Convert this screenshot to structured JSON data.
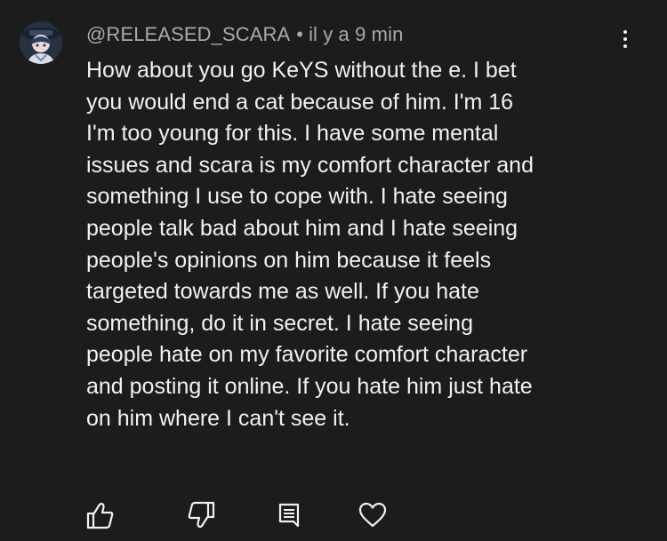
{
  "comment": {
    "author": "@RELEASED_SCARA",
    "separator": "•",
    "timestamp": "il y a 9 min",
    "body_lines": [
      "How about you go KeYS without the e. I bet",
      "you would end a cat because of him. I'm 16",
      "I'm too young for this. I have some mental",
      "issues and scara is my comfort character and",
      "something I use to cope with. I hate seeing",
      "people talk bad about him and I hate seeing",
      "people's opinions on him because it feels",
      "targeted towards me as well. If you hate",
      "something, do it in secret. I hate seeing",
      "people hate on my favorite comfort character",
      "and posting it online. If you hate him just hate",
      "on him where I can't see it."
    ]
  },
  "icons": {
    "avatar": "avatar-image",
    "more": "more-vertical-icon",
    "like": "thumbs-up-icon",
    "dislike": "thumbs-down-icon",
    "reply": "reply-comment-icon",
    "heart": "heart-icon"
  },
  "colors": {
    "background": "#1c1c1c",
    "text": "#f1f1f1",
    "meta": "#aaaaaa"
  }
}
